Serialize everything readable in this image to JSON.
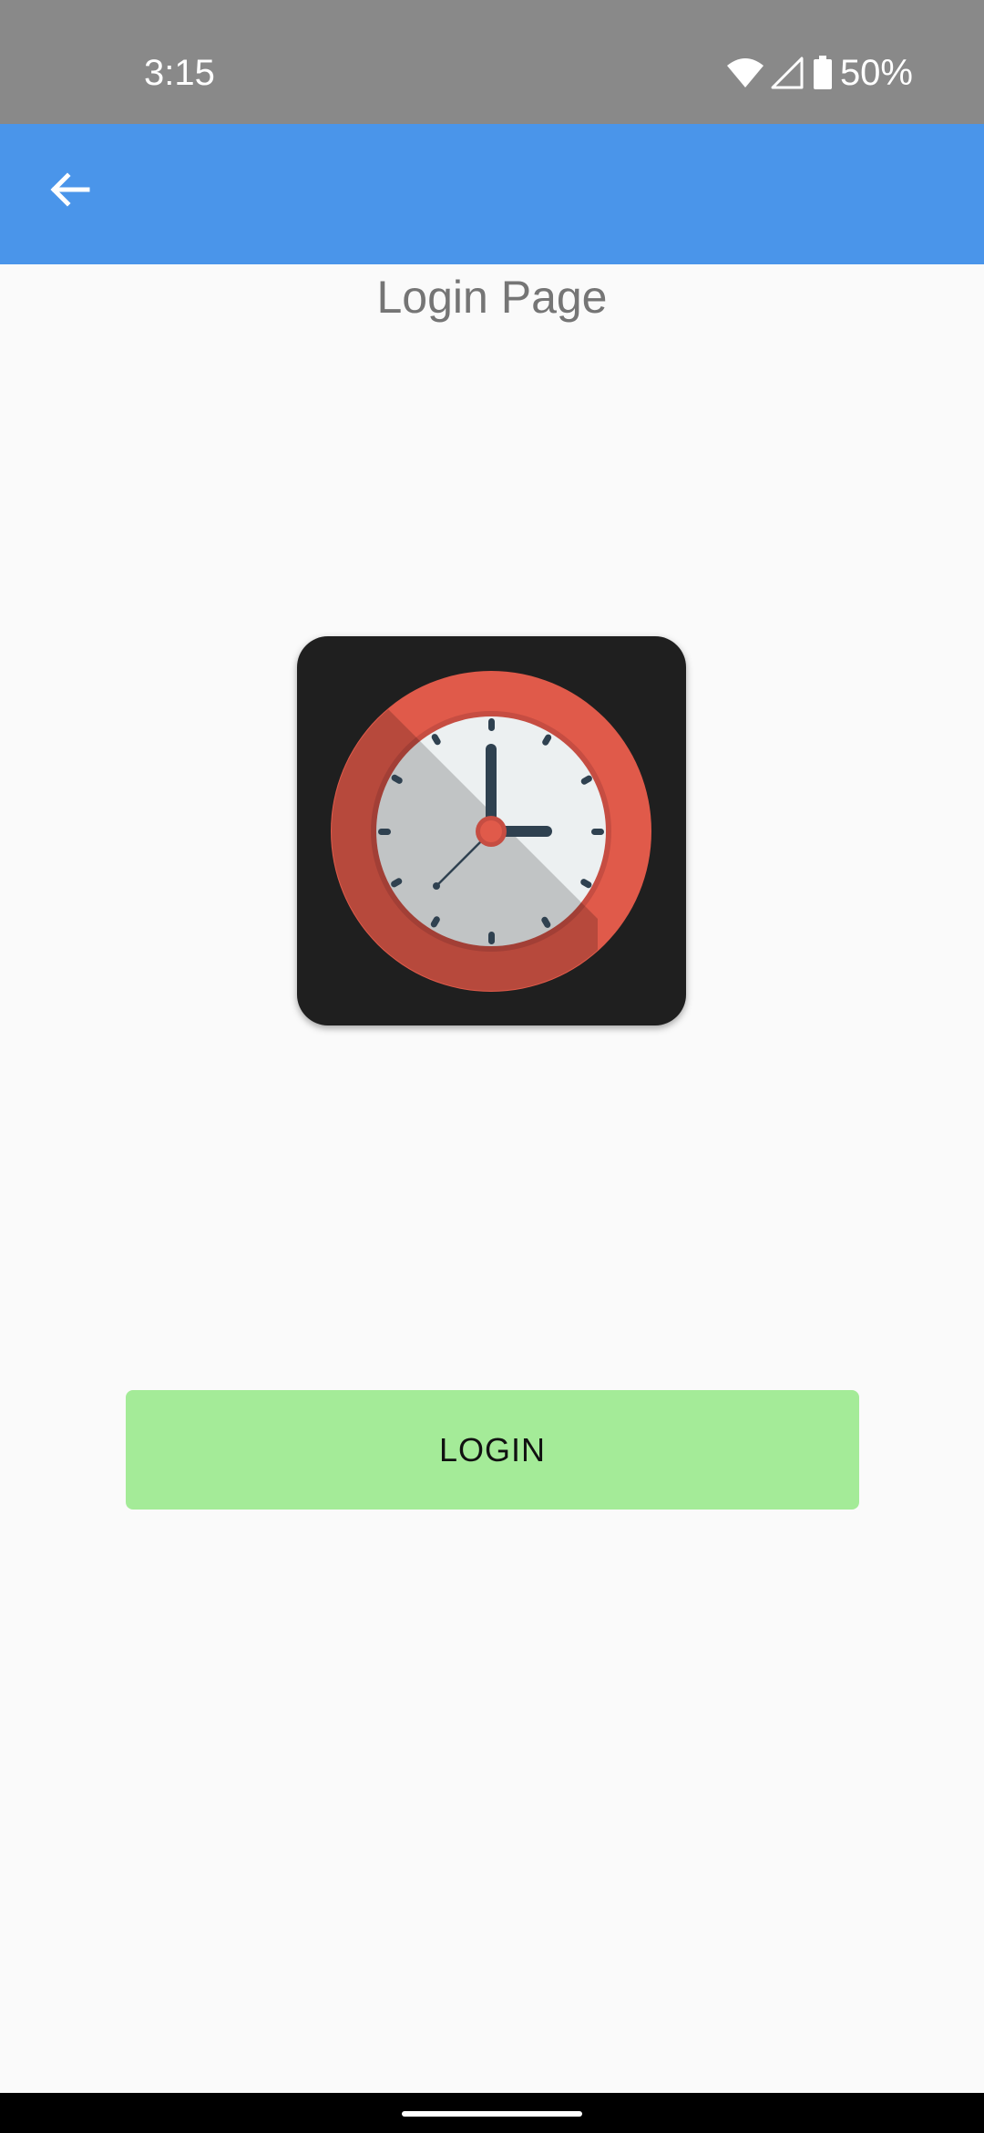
{
  "status_bar": {
    "time": "3:15",
    "battery_percent": "50%",
    "icons": [
      "wifi-icon",
      "cell-signal-icon",
      "battery-icon"
    ]
  },
  "app_bar": {
    "back_icon": "arrow-left-icon",
    "color": "#4a95ea"
  },
  "page": {
    "title": "Login Page",
    "logo_icon": "clock-icon"
  },
  "login_button": {
    "label": "LOGIN",
    "color": "#a4eb98"
  }
}
